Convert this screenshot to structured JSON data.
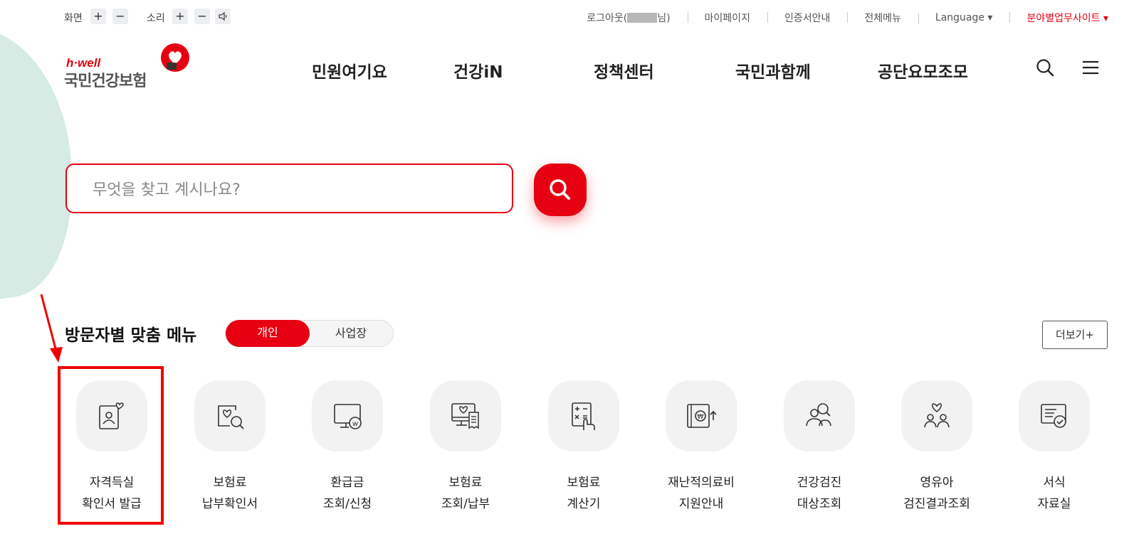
{
  "utility": {
    "screen_label": "화면",
    "sound_label": "소리",
    "plus": "+",
    "minus": "−",
    "logout": "로그아웃(",
    "logout_suffix": "님)",
    "mypage": "마이페이지",
    "cert": "인증서안내",
    "allmenu": "전체메뉴",
    "language": "Language ▾",
    "sites": "분야별업무사이트 ▾"
  },
  "logo": {
    "brand_en": "h·well",
    "brand_kr": "국민건강보험"
  },
  "nav": [
    "민원여기요",
    "건강iN",
    "정책센터",
    "국민과함께",
    "공단요모조모"
  ],
  "search": {
    "placeholder": "무엇을 찾고 계시나요?"
  },
  "section": {
    "title": "방문자별 맞춤 메뉴",
    "tab_active": "개인",
    "tab_inactive": "사업장",
    "more": "더보기+"
  },
  "menu_items": [
    {
      "label": "자격득실\n확인서 발급",
      "icon": "id-card-heart-icon"
    },
    {
      "label": "보험료\n납부확인서",
      "icon": "document-search-icon"
    },
    {
      "label": "환급금\n조회/신청",
      "icon": "monitor-won-icon"
    },
    {
      "label": "보험료\n조회/납부",
      "icon": "monitor-receipt-icon"
    },
    {
      "label": "보험료\n계산기",
      "icon": "calculator-icon"
    },
    {
      "label": "재난적의료비\n지원안내",
      "icon": "wallet-won-up-icon"
    },
    {
      "label": "건강검진\n대상조회",
      "icon": "people-search-icon"
    },
    {
      "label": "영유아\n검진결과조회",
      "icon": "family-heart-icon"
    },
    {
      "label": "서식\n자료실",
      "icon": "form-check-icon"
    }
  ],
  "colors": {
    "accent": "#e60012",
    "blob": "#d6ebe3",
    "icon_bg": "#f2f2f2"
  }
}
